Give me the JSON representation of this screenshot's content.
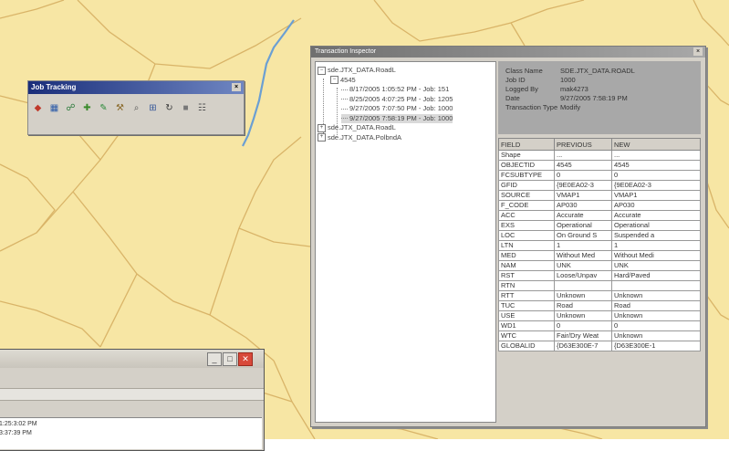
{
  "colors": {
    "map_background": "#f7e6a4",
    "map_lines": "#d9b468",
    "river": "#6b9fd3",
    "window_face": "#d4d0c8",
    "info_panel": "#a8a8a8"
  },
  "job_tracking_toolbar": {
    "title": "Job Tracking",
    "close_glyph": "×",
    "buttons": [
      {
        "icon": "add-diamond-icon",
        "glyph": "◆"
      },
      {
        "icon": "grid-icon",
        "glyph": "▦"
      },
      {
        "icon": "job-icon",
        "glyph": "☍"
      },
      {
        "icon": "new-job-icon",
        "glyph": "✚"
      },
      {
        "icon": "edit-icon",
        "glyph": "✎"
      },
      {
        "icon": "tool-icon",
        "glyph": "⚒"
      },
      {
        "icon": "search-icon",
        "glyph": "⌕"
      },
      {
        "icon": "select-icon",
        "glyph": "⊞"
      },
      {
        "icon": "refresh-icon",
        "glyph": "↻"
      },
      {
        "icon": "stop-icon",
        "glyph": "■"
      },
      {
        "icon": "properties-icon",
        "glyph": "☷"
      }
    ]
  },
  "inspector": {
    "title": "Transaction Inspector",
    "close_glyph": "×",
    "tree": [
      {
        "label": "sde.JTX_DATA.RoadL",
        "expander": "⊟",
        "level": 0
      },
      {
        "label": "4545",
        "expander": "⊟",
        "level": 1
      },
      {
        "label": "8/17/2005 1:05:52 PM - Job: 151",
        "level": 2
      },
      {
        "label": "8/25/2005 4:07:25 PM - Job: 1205",
        "level": 2
      },
      {
        "label": "9/27/2005 7:07:50 PM - Job: 1000",
        "level": 2
      },
      {
        "label": "9/27/2005 7:58:19 PM - Job: 1000",
        "level": 2,
        "selected": true
      },
      {
        "label": "sde.JTX_DATA.RoadL",
        "expander": "⊞",
        "level": 0
      },
      {
        "label": "sde.JTX_DATA.PolbndA",
        "expander": "⊞",
        "level": 0
      }
    ],
    "info": {
      "class_name_label": "Class Name",
      "class_name": "SDE.JTX_DATA.ROADL",
      "job_id_label": "Job ID",
      "job_id": "1000",
      "logged_by_label": "Logged By",
      "logged_by": "mak4273",
      "date_label": "Date",
      "date": "9/27/2005 7:58:19 PM",
      "transaction_type_label": "Transaction Type",
      "transaction_type": "Modify"
    },
    "grid": {
      "columns": [
        "FIELD",
        "PREVIOUS",
        "NEW"
      ],
      "rows": [
        [
          "Shape",
          "...",
          "..."
        ],
        [
          "OBJECTID",
          "4545",
          "4545"
        ],
        [
          "FCSUBTYPE",
          "0",
          "0"
        ],
        [
          "GFID",
          "{9E0EA02-3",
          "{9E0EA02-3"
        ],
        [
          "SOURCE",
          "VMAP1",
          "VMAP1"
        ],
        [
          "F_CODE",
          "AP030",
          "AP030"
        ],
        [
          "ACC",
          "Accurate",
          "Accurate"
        ],
        [
          "EXS",
          "Operational",
          "Operational"
        ],
        [
          "LOC",
          "On Ground S",
          "Suspended a"
        ],
        [
          "LTN",
          "1",
          "1"
        ],
        [
          "MED",
          "Without Med",
          "Without Medi"
        ],
        [
          "NAM",
          "UNK",
          "UNK"
        ],
        [
          "RST",
          "Loose/Unpav",
          "Hard/Paved"
        ],
        [
          "RTN",
          "",
          ""
        ],
        [
          "RTT",
          "Unknown",
          "Unknown"
        ],
        [
          "TUC",
          "Road",
          "Road"
        ],
        [
          "USE",
          "Unknown",
          "Unknown"
        ],
        [
          "WD1",
          "0",
          "0"
        ],
        [
          "WTC",
          "Fair/Dry Weat",
          "Unknown"
        ],
        [
          "GLOBALID",
          "{D63E300E-7",
          "{D63E300E-1"
        ]
      ]
    }
  },
  "bottom_window": {
    "minimize_glyph": "_",
    "maximize_glyph": "□",
    "close_glyph": "✕",
    "rows": [
      "1:25:3:02 PM",
      "3:37:39 PM"
    ]
  }
}
